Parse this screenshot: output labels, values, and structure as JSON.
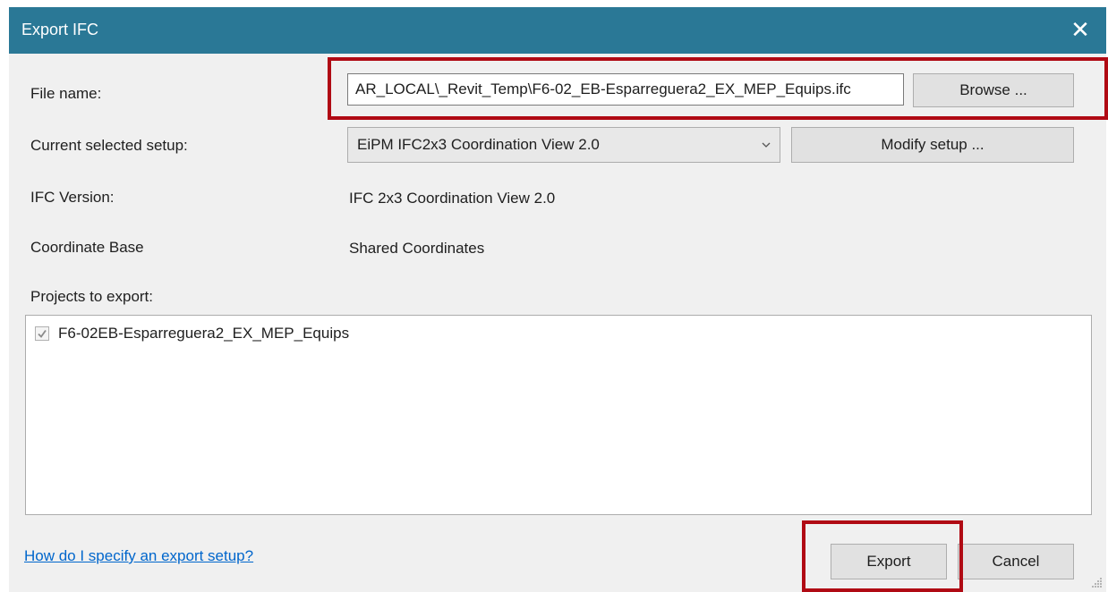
{
  "window": {
    "title": "Export IFC",
    "close_glyph": "✕"
  },
  "form": {
    "file_name_label": "File name:",
    "file_name_value": "AR_LOCAL\\_Revit_Temp\\F6-02_EB-Esparreguera2_EX_MEP_Equips.ifc",
    "browse_label": "Browse ...",
    "setup_label": "Current selected setup:",
    "setup_value": "EiPM IFC2x3 Coordination View 2.0",
    "modify_setup_label": "Modify setup ...",
    "ifc_version_label": "IFC Version:",
    "ifc_version_value": "IFC 2x3 Coordination View 2.0",
    "coordinate_base_label": "Coordinate Base",
    "coordinate_base_value": "Shared Coordinates",
    "projects_label": "Projects to export:",
    "projects": [
      {
        "name": "F6-02EB-Esparreguera2_EX_MEP_Equips",
        "checked": true
      }
    ]
  },
  "footer": {
    "help_link": "How do I specify an export setup?",
    "export_label": "Export",
    "cancel_label": "Cancel"
  },
  "icons": {
    "close": "close-icon",
    "dropdown": "chevron-down-icon",
    "check": "check-icon",
    "resize": "resize-grip-icon"
  },
  "colors": {
    "titlebar": "#2a7896",
    "highlight": "#b00a14",
    "link": "#0066cc",
    "dialog_bg": "#f0f0f0"
  }
}
